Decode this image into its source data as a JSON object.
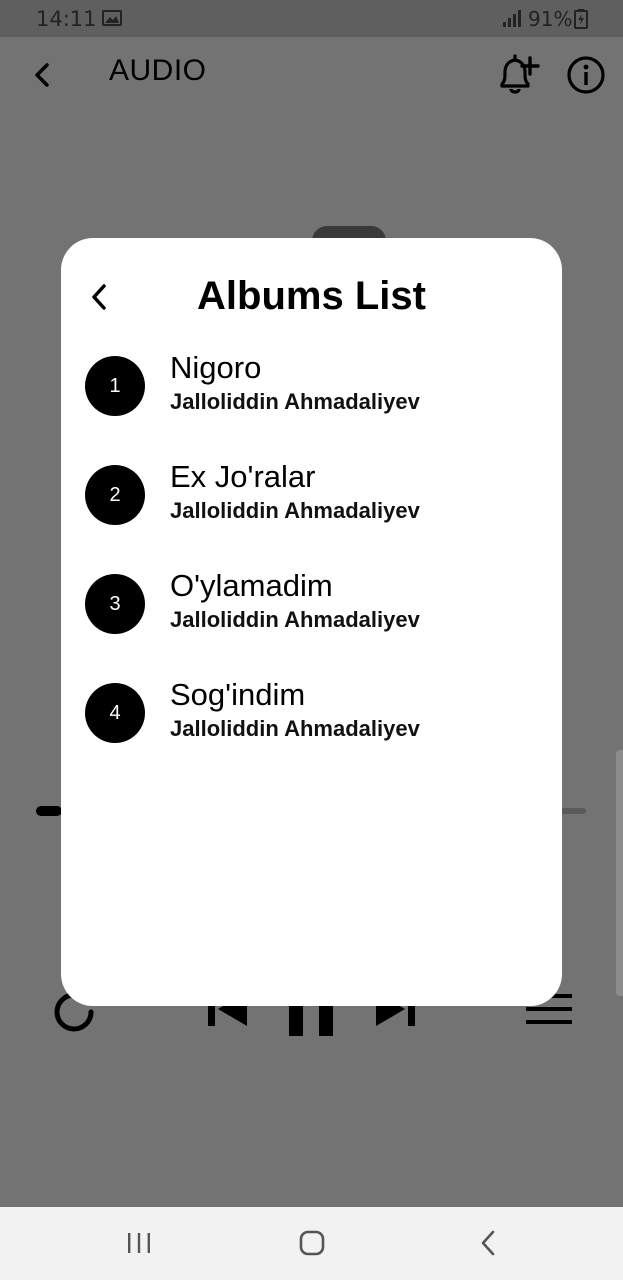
{
  "status_bar": {
    "time": "14:11",
    "battery": "91%"
  },
  "app_header": {
    "title": "AUDIO"
  },
  "modal": {
    "title": "Albums List",
    "albums": [
      {
        "number": "1",
        "title": "Nigoro",
        "artist": "Jalloliddin Ahmadaliyev"
      },
      {
        "number": "2",
        "title": "Ex Jo'ralar",
        "artist": "Jalloliddin Ahmadaliyev"
      },
      {
        "number": "3",
        "title": "O'ylamadim",
        "artist": "Jalloliddin Ahmadaliyev"
      },
      {
        "number": "4",
        "title": "Sog'indim",
        "artist": "Jalloliddin Ahmadaliyev"
      }
    ]
  },
  "colors": {
    "overlay": "#737373",
    "modal_bg": "#ffffff",
    "number_badge": "#000000",
    "nav_bar": "#f2f2f2"
  },
  "icons": {
    "app_back": "chevron-left-icon",
    "bell_add": "bell-plus-icon",
    "info": "info-circle-icon",
    "modal_back": "chevron-left-icon",
    "repeat": "repeat-icon",
    "previous": "skip-previous-icon",
    "pause": "pause-icon",
    "next": "skip-next-icon",
    "playlist": "menu-icon"
  }
}
